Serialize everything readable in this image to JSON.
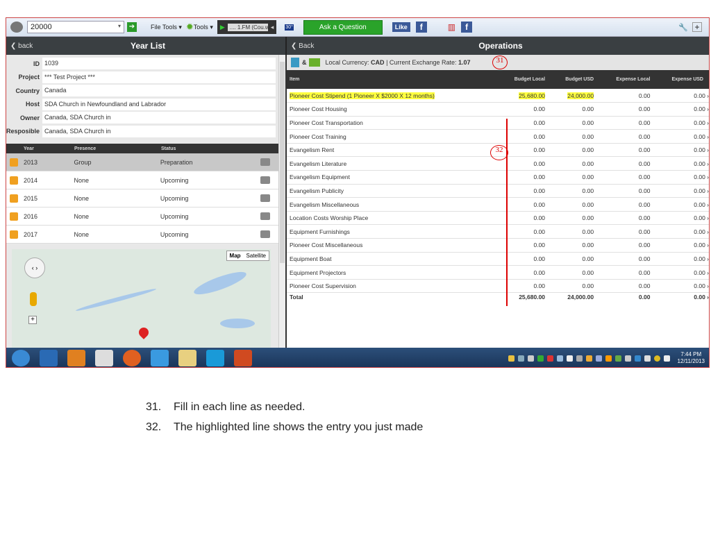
{
  "toolbar": {
    "search_value": "20000",
    "file_tools": "File Tools",
    "tools": "Tools",
    "radio_station": ".... 1.FM (Cou.w",
    "weather_temp": "30°",
    "ask_button": "Ask a Question",
    "like_button": "Like",
    "fb_badge": "f"
  },
  "left": {
    "back": "back",
    "title": "Year List",
    "info": [
      {
        "label": "ID",
        "value": "1039"
      },
      {
        "label": "Project",
        "value": "*** Test Project ***"
      },
      {
        "label": "Country",
        "value": "Canada"
      },
      {
        "label": "Host",
        "value": "SDA Church in Newfoundland and Labrador"
      },
      {
        "label": "Owner",
        "value": "Canada, SDA Church in"
      },
      {
        "label": "Resposible",
        "value": "Canada, SDA Church in"
      }
    ],
    "year_headers": [
      "Year",
      "Presence",
      "Status"
    ],
    "years": [
      {
        "year": "2013",
        "presence": "Group",
        "status": "Preparation"
      },
      {
        "year": "2014",
        "presence": "None",
        "status": "Upcoming"
      },
      {
        "year": "2015",
        "presence": "None",
        "status": "Upcoming"
      },
      {
        "year": "2016",
        "presence": "None",
        "status": "Upcoming"
      },
      {
        "year": "2017",
        "presence": "None",
        "status": "Upcoming"
      }
    ],
    "map": {
      "map_label": "Map",
      "satellite_label": "Satellite"
    }
  },
  "right": {
    "back": "Back",
    "title": "Operations",
    "amp": "&",
    "currency_label": "Local Currency:",
    "currency": "CAD",
    "sep": "|",
    "rate_label": "Current Exchange Rate:",
    "rate": "1.07",
    "headers": [
      "Item",
      "Budget Local",
      "Budget USD",
      "Expense Local",
      "Expense USD"
    ],
    "rows": [
      [
        "Pioneer Cost Stipend (1 Pioneer X $2000 X 12 months)",
        "25,680.00",
        "24,000.00",
        "0.00",
        "0.00"
      ],
      [
        "Pioneer Cost Housing",
        "0.00",
        "0.00",
        "0.00",
        "0.00"
      ],
      [
        "Pioneer Cost Transportation",
        "0.00",
        "0.00",
        "0.00",
        "0.00"
      ],
      [
        "Pioneer Cost Training",
        "0.00",
        "0.00",
        "0.00",
        "0.00"
      ],
      [
        "Evangelism Rent",
        "0.00",
        "0.00",
        "0.00",
        "0.00"
      ],
      [
        "Evangelism Literature",
        "0.00",
        "0.00",
        "0.00",
        "0.00"
      ],
      [
        "Evangelism Equipment",
        "0.00",
        "0.00",
        "0.00",
        "0.00"
      ],
      [
        "Evangelism Publicity",
        "0.00",
        "0.00",
        "0.00",
        "0.00"
      ],
      [
        "Evangelism Miscellaneous",
        "0.00",
        "0.00",
        "0.00",
        "0.00"
      ],
      [
        "Location Costs Worship Place",
        "0.00",
        "0.00",
        "0.00",
        "0.00"
      ],
      [
        "Equipment Furnishings",
        "0.00",
        "0.00",
        "0.00",
        "0.00"
      ],
      [
        "Pioneer Cost Miscellaneous",
        "0.00",
        "0.00",
        "0.00",
        "0.00"
      ],
      [
        "Equipment Boat",
        "0.00",
        "0.00",
        "0.00",
        "0.00"
      ],
      [
        "Equipment Projectors",
        "0.00",
        "0.00",
        "0.00",
        "0.00"
      ],
      [
        "Pioneer Cost Supervision",
        "0.00",
        "0.00",
        "0.00",
        "0.00"
      ]
    ],
    "total": [
      "Total",
      "25,680.00",
      "24,000.00",
      "0.00",
      "0.00"
    ]
  },
  "annotations": {
    "a31": "31",
    "a32": "32"
  },
  "taskbar": {
    "time": "7:44 PM",
    "date": "12/11/2013"
  },
  "notes": [
    {
      "num": "31.",
      "text": "Fill in each line as needed."
    },
    {
      "num": "32.",
      "text": "The highlighted line shows the entry you just made"
    }
  ]
}
